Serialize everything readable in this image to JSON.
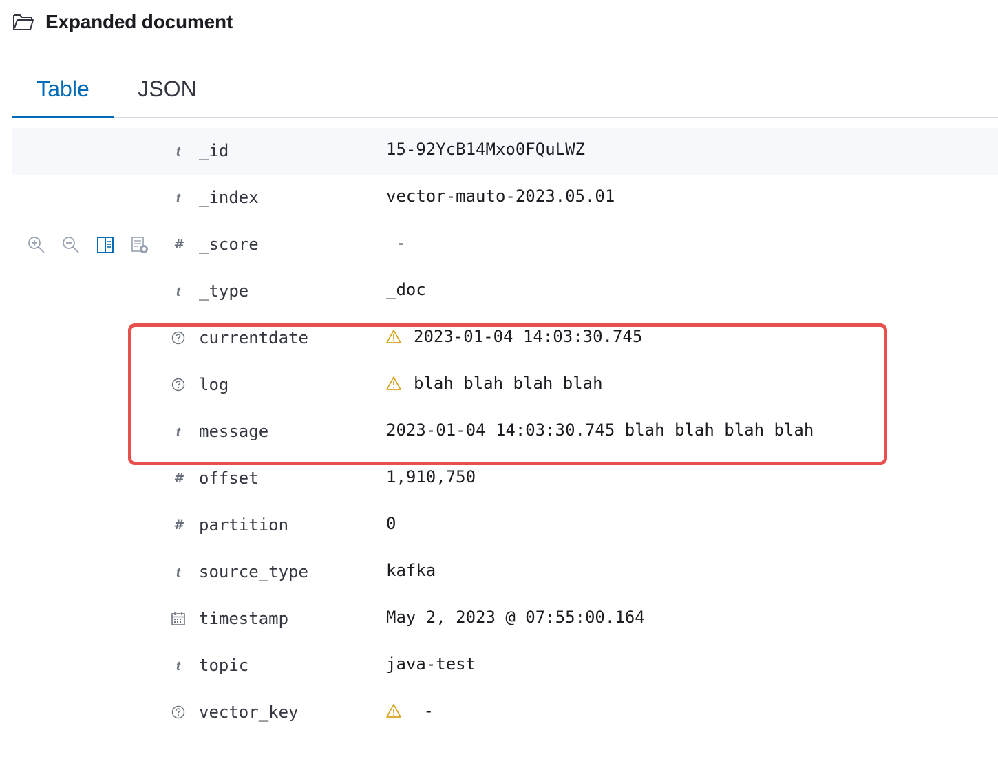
{
  "header": {
    "title": "Expanded document",
    "icon": "folder-icon"
  },
  "tabs": [
    {
      "label": "Table",
      "active": true
    },
    {
      "label": "JSON",
      "active": false
    }
  ],
  "actions": [
    "zoom-in-icon",
    "zoom-out-icon",
    "toggle-column-icon",
    "filter-for-field-present-icon"
  ],
  "fields": [
    {
      "type": "t",
      "name": "_id",
      "value": "15-92YcB14Mxo0FQuLWZ"
    },
    {
      "type": "t",
      "name": "_index",
      "value": "vector-mauto-2023.05.01"
    },
    {
      "type": "#",
      "name": "_score",
      "value": " -"
    },
    {
      "type": "t",
      "name": "_type",
      "value": "_doc"
    },
    {
      "type": "?",
      "name": "currentdate",
      "value": "2023-01-04 14:03:30.745",
      "warning": true
    },
    {
      "type": "?",
      "name": "log",
      "value": "blah blah blah blah",
      "warning": true
    },
    {
      "type": "t",
      "name": "message",
      "value": "2023-01-04 14:03:30.745 blah blah blah blah"
    },
    {
      "type": "#",
      "name": "offset",
      "value": "1,910,750"
    },
    {
      "type": "#",
      "name": "partition",
      "value": "0"
    },
    {
      "type": "t",
      "name": "source_type",
      "value": "kafka"
    },
    {
      "type": "date",
      "name": "timestamp",
      "value": "May 2, 2023 @ 07:55:00.164"
    },
    {
      "type": "t",
      "name": "topic",
      "value": "java-test"
    },
    {
      "type": "?",
      "name": "vector_key",
      "value": " -",
      "warning": true
    }
  ],
  "colors": {
    "accent": "#006bb8",
    "highlight": "#e8504d",
    "warning": "#d6a21f",
    "stripe": "#f6f8fb"
  }
}
